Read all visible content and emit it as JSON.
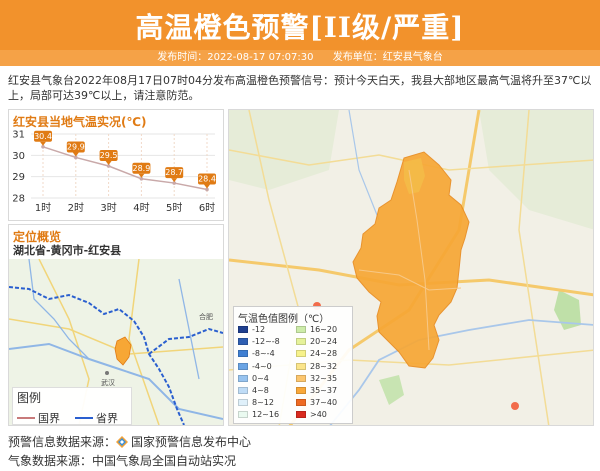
{
  "header": {
    "title": "高温橙色预警[II级/严重]",
    "time_label": "发布时间：2022-08-17 07:07:30",
    "unit_label": "发布单位：红安县气象台"
  },
  "description": "红安县气象台2022年08月17日07时04分发布高温橙色预警信号：预计今天白天，我县大部地区最高气温将升至37℃以上，局部可达39℃以上，请注意防范。",
  "chart_panel": {
    "title": "红安县当地气温实况(℃)"
  },
  "chart_data": {
    "type": "line",
    "title": "红安县当地气温实况(℃)",
    "categories": [
      "1时",
      "2时",
      "3时",
      "4时",
      "5时",
      "6时"
    ],
    "values": [
      30.4,
      29.9,
      29.5,
      28.9,
      28.7,
      28.4
    ],
    "yticks": [
      28,
      29,
      30,
      31
    ],
    "ylim": [
      28,
      31
    ],
    "grid": true,
    "colors": {
      "line": "#c9a9a9",
      "label": "#e07b14"
    }
  },
  "location_panel": {
    "title": "定位概览",
    "path": "湖北省-黄冈市-红安县",
    "legend_title": "图例",
    "legend_items": [
      {
        "label": "国界",
        "color": "#c87a7a"
      },
      {
        "label": "省界",
        "color": "#2a5fcf"
      }
    ],
    "city_labels": [
      "武汉",
      "合肥"
    ]
  },
  "temp_legend": {
    "title": "气温色值图例（℃）",
    "items": [
      {
        "label": "-12",
        "color": "#1f3f8f"
      },
      {
        "label": "-12~-8",
        "color": "#2f5fb2"
      },
      {
        "label": "-8~-4",
        "color": "#3f7fd2"
      },
      {
        "label": "-4~0",
        "color": "#6aa4e4"
      },
      {
        "label": "0~4",
        "color": "#97c3ef"
      },
      {
        "label": "4~8",
        "color": "#bfdcf6"
      },
      {
        "label": "8~12",
        "color": "#dff0fa"
      },
      {
        "label": "12~16",
        "color": "#eafaf0"
      },
      {
        "label": "16~20",
        "color": "#cdeca9"
      },
      {
        "label": "20~24",
        "color": "#e6f29a"
      },
      {
        "label": "24~28",
        "color": "#f7f28a"
      },
      {
        "label": "28~32",
        "color": "#fbe58a"
      },
      {
        "label": "32~35",
        "color": "#fcc66e"
      },
      {
        "label": "35~37",
        "color": "#f9a83a"
      },
      {
        "label": "37~40",
        "color": "#ee6a22"
      },
      {
        "label": ">40",
        "color": "#d92a1e"
      }
    ]
  },
  "footer": {
    "warning_source": "预警信息数据来源：",
    "warning_source_name": "国家预警信息发布中心",
    "weather_source": "气象数据来源：中国气象局全国自动站实况"
  },
  "colors": {
    "header": "#f2922c",
    "region_fill": "#f7a735",
    "accent": "#e07b14"
  }
}
